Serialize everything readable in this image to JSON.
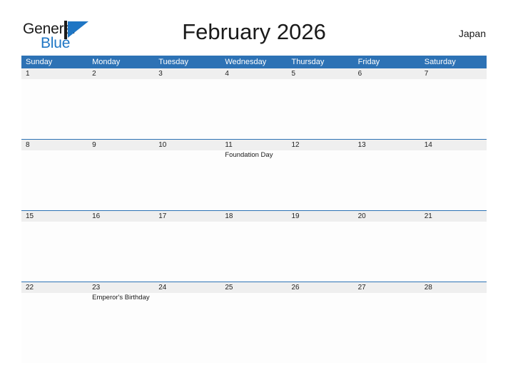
{
  "brand": {
    "name_part1": "General",
    "name_part2": "Blue",
    "logo_icon": "triangle-flag-logo",
    "accent_color": "#1f76c4"
  },
  "header": {
    "title": "February 2026",
    "country": "Japan"
  },
  "theme": {
    "header_blue": "#2d72b5",
    "date_band": "#efefef",
    "body_white": "#fdfdfd",
    "rule_blue": "#2d72b5"
  },
  "weekdays": [
    "Sunday",
    "Monday",
    "Tuesday",
    "Wednesday",
    "Thursday",
    "Friday",
    "Saturday"
  ],
  "weeks": [
    {
      "dates": [
        "1",
        "2",
        "3",
        "4",
        "5",
        "6",
        "7"
      ],
      "events": [
        "",
        "",
        "",
        "",
        "",
        "",
        ""
      ]
    },
    {
      "dates": [
        "8",
        "9",
        "10",
        "11",
        "12",
        "13",
        "14"
      ],
      "events": [
        "",
        "",
        "",
        "Foundation Day",
        "",
        "",
        ""
      ]
    },
    {
      "dates": [
        "15",
        "16",
        "17",
        "18",
        "19",
        "20",
        "21"
      ],
      "events": [
        "",
        "",
        "",
        "",
        "",
        "",
        ""
      ]
    },
    {
      "dates": [
        "22",
        "23",
        "24",
        "25",
        "26",
        "27",
        "28"
      ],
      "events": [
        "",
        "Emperor's Birthday",
        "",
        "",
        "",
        "",
        ""
      ]
    }
  ]
}
